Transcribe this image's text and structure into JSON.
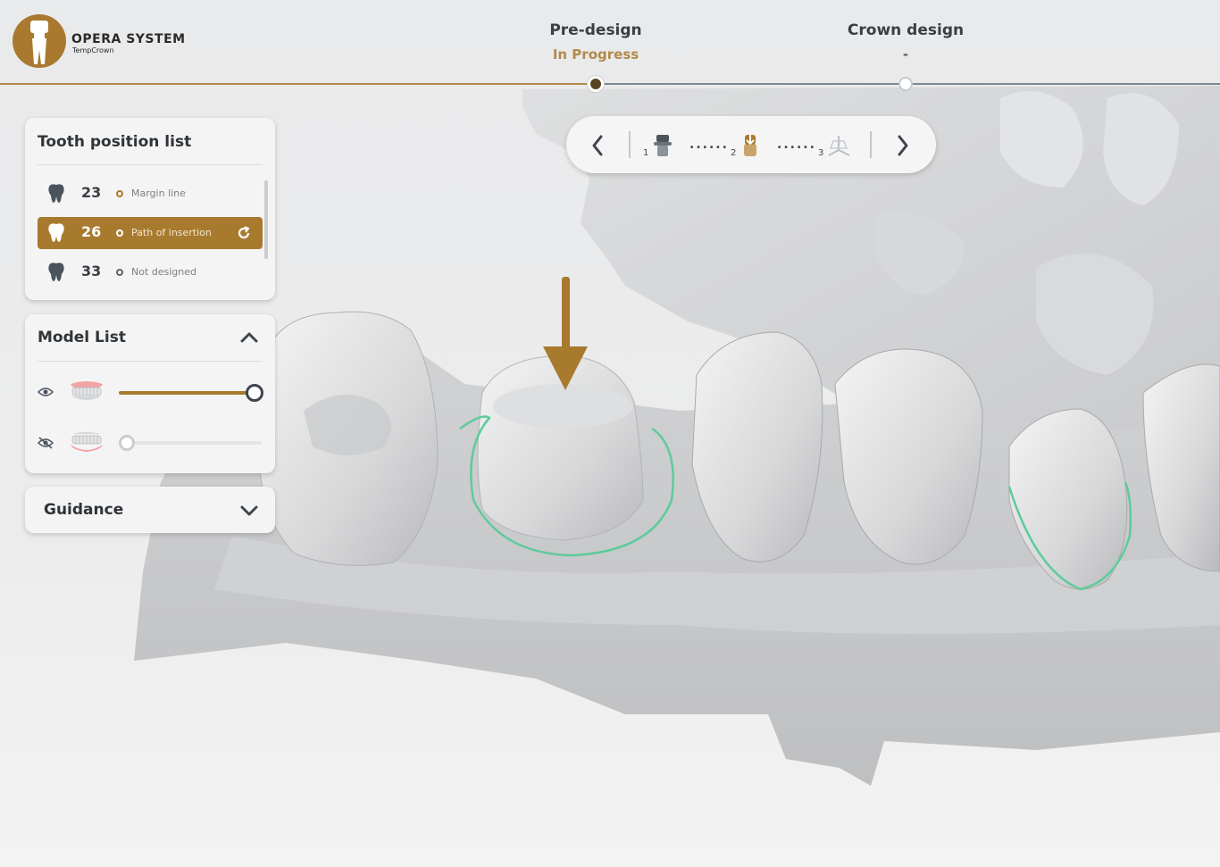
{
  "app": {
    "brand_name": "OPERA SYSTEM",
    "brand_sub": "TempCrown",
    "accent_color": "#a87a2e"
  },
  "steps": [
    {
      "title": "Pre-design",
      "status": "In Progress",
      "state": "active"
    },
    {
      "title": "Crown design",
      "status": "-",
      "state": "pending"
    }
  ],
  "toolbar": {
    "prev_icon": "chevron-left-icon",
    "next_icon": "chevron-right-icon",
    "steps": [
      {
        "number": "1",
        "icon": "abutment-icon",
        "dots": "......"
      },
      {
        "number": "2",
        "icon": "path-of-insertion-icon",
        "dots": "......"
      },
      {
        "number": "3",
        "icon": "coordinate-axes-icon"
      }
    ]
  },
  "tooth_panel": {
    "title": "Tooth position list",
    "rows": [
      {
        "number": "23",
        "status": "Margin line",
        "selected": false
      },
      {
        "number": "26",
        "status": "Path of insertion",
        "selected": true
      },
      {
        "number": "33",
        "status": "Not designed",
        "selected": false
      }
    ]
  },
  "model_panel": {
    "title": "Model List",
    "models": [
      {
        "name": "upper-jaw",
        "visible": true,
        "opacity": 1.0
      },
      {
        "name": "lower-jaw",
        "visible": false,
        "opacity": 0.0
      }
    ]
  },
  "guidance_panel": {
    "title": "Guidance"
  }
}
